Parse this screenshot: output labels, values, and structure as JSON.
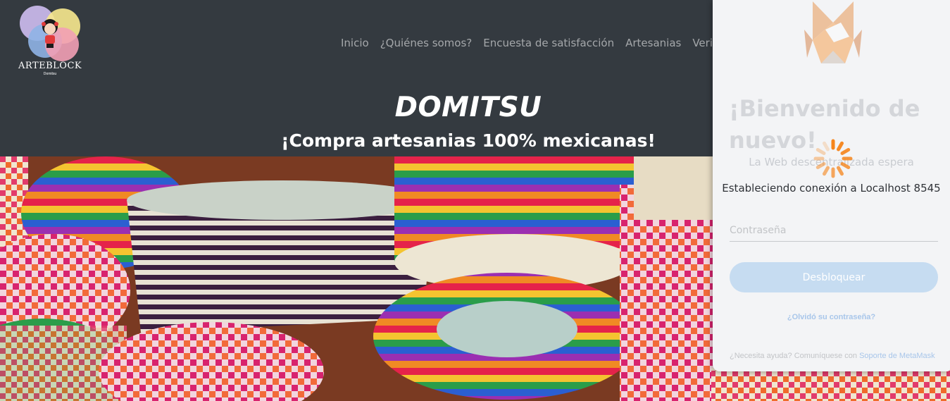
{
  "brand": {
    "name": "ARTEBLOCK",
    "sub": "Domitsu"
  },
  "nav": [
    {
      "label": "Inicio"
    },
    {
      "label": "¿Quiénes somos?"
    },
    {
      "label": "Encuesta de satisfacción"
    },
    {
      "label": "Artesanias"
    },
    {
      "label": "Verificar"
    }
  ],
  "hero": {
    "title": "DOMITSU",
    "subtitle": "¡Compra artesanias 100% mexicanas!"
  },
  "metamask": {
    "welcome": "¡Bienvenido de nuevo!",
    "tagline": "La Web descentralizada espera",
    "connecting": "Estableciendo conexión a Localhost 8545",
    "password_placeholder": "Contraseña",
    "unlock_label": "Desbloquear",
    "forgot_label": "¿Olvidó su contraseña?",
    "help_text": "¿Necesita ayuda? Comuníquese con ",
    "help_link": "Soporte de MetaMask"
  },
  "colors": {
    "header_bg": "#343a40",
    "popup_bg": "#f3f4f6",
    "accent_blue": "#c6dcf1",
    "spinner": "#f6851b"
  }
}
